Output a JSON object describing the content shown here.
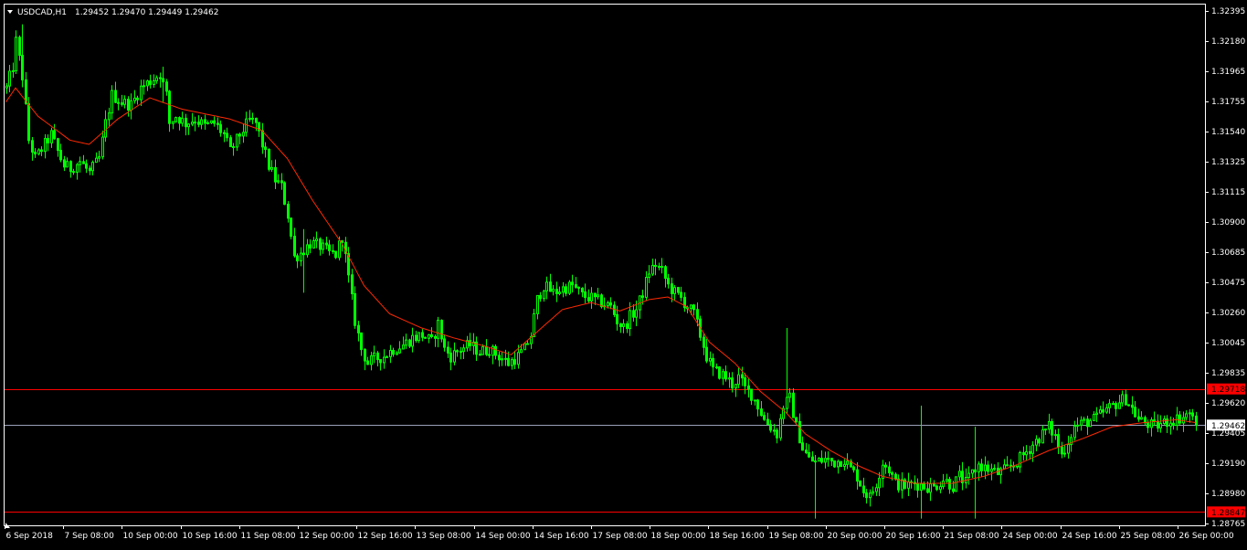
{
  "header": {
    "symbol": "USDCAD,H1",
    "ohlc": "1.29452 1.29470 1.29449 1.29462"
  },
  "colors": {
    "background": "#000000",
    "border": "#ffffff",
    "bull_candle": "#00ff00",
    "bear_candle": "#00ff00",
    "moving_average": "#ff2a00",
    "hline": "#ff0000",
    "bid_line": "#9aa0b8",
    "price_tag_red": "#ff0000",
    "price_tag_bid": "#ffffff"
  },
  "chart_data": {
    "type": "candlestick",
    "symbol": "USDCAD",
    "timeframe": "H1",
    "ylim": [
      1.2876,
      1.3242
    ],
    "y_ticks": [
      "1.32395",
      "1.32180",
      "1.31965",
      "1.31755",
      "1.31540",
      "1.31325",
      "1.31115",
      "1.30900",
      "1.30685",
      "1.30475",
      "1.30260",
      "1.30045",
      "1.29835",
      "1.29620",
      "1.29405",
      "1.29190",
      "1.28980",
      "1.28765"
    ],
    "x_ticks": [
      "6 Sep 2018",
      "7 Sep 08:00",
      "10 Sep 00:00",
      "10 Sep 16:00",
      "11 Sep 08:00",
      "12 Sep 00:00",
      "12 Sep 16:00",
      "13 Sep 08:00",
      "14 Sep 00:00",
      "14 Sep 16:00",
      "17 Sep 08:00",
      "18 Sep 00:00",
      "18 Sep 16:00",
      "19 Sep 08:00",
      "20 Sep 00:00",
      "20 Sep 16:00",
      "21 Sep 08:00",
      "24 Sep 00:00",
      "24 Sep 16:00",
      "25 Sep 08:00",
      "26 Sep 00:00"
    ],
    "path_knots": [
      [
        0,
        1.3185
      ],
      [
        2,
        1.32
      ],
      [
        3,
        1.3218
      ],
      [
        5,
        1.3193
      ],
      [
        7,
        1.3148
      ],
      [
        9,
        1.3135
      ],
      [
        12,
        1.3145
      ],
      [
        14,
        1.3152
      ],
      [
        16,
        1.314
      ],
      [
        18,
        1.313
      ],
      [
        20,
        1.3128
      ],
      [
        23,
        1.3133
      ],
      [
        26,
        1.3125
      ],
      [
        29,
        1.3135
      ],
      [
        31,
        1.316
      ],
      [
        33,
        1.318
      ],
      [
        36,
        1.3175
      ],
      [
        39,
        1.3173
      ],
      [
        42,
        1.3185
      ],
      [
        45,
        1.319
      ],
      [
        48,
        1.3195
      ],
      [
        50,
        1.318
      ],
      [
        51,
        1.316
      ],
      [
        53,
        1.3165
      ],
      [
        56,
        1.316
      ],
      [
        59,
        1.3163
      ],
      [
        62,
        1.3158
      ],
      [
        65,
        1.316
      ],
      [
        68,
        1.3152
      ],
      [
        70,
        1.314
      ],
      [
        73,
        1.3152
      ],
      [
        76,
        1.3162
      ],
      [
        78,
        1.316
      ],
      [
        80,
        1.3145
      ],
      [
        82,
        1.313
      ],
      [
        84,
        1.312
      ],
      [
        86,
        1.3115
      ],
      [
        88,
        1.3095
      ],
      [
        90,
        1.3065
      ],
      [
        92,
        1.3068
      ],
      [
        95,
        1.3075
      ],
      [
        98,
        1.3073
      ],
      [
        101,
        1.3068
      ],
      [
        103,
        1.3067
      ],
      [
        105,
        1.308
      ],
      [
        107,
        1.305
      ],
      [
        109,
        1.302
      ],
      [
        111,
        1.3
      ],
      [
        113,
        1.299
      ],
      [
        115,
        1.2993
      ],
      [
        118,
        1.2995
      ],
      [
        121,
        1.3
      ],
      [
        124,
        1.3003
      ],
      [
        127,
        1.3008
      ],
      [
        130,
        1.301
      ],
      [
        133,
        1.3005
      ],
      [
        135,
        1.3018
      ],
      [
        137,
        1.3
      ],
      [
        139,
        1.2995
      ],
      [
        142,
        1.3
      ],
      [
        145,
        1.3003
      ],
      [
        148,
        1.2998
      ],
      [
        151,
        1.3
      ],
      [
        154,
        1.2995
      ],
      [
        157,
        1.299
      ],
      [
        160,
        1.2995
      ],
      [
        162,
        1.3
      ],
      [
        164,
        1.301
      ],
      [
        166,
        1.3035
      ],
      [
        168,
        1.3045
      ],
      [
        171,
        1.304
      ],
      [
        174,
        1.3043
      ],
      [
        177,
        1.3045
      ],
      [
        180,
        1.3038
      ],
      [
        183,
        1.3036
      ],
      [
        186,
        1.3033
      ],
      [
        189,
        1.303
      ],
      [
        191,
        1.302
      ],
      [
        193,
        1.3015
      ],
      [
        195,
        1.3023
      ],
      [
        197,
        1.3028
      ],
      [
        199,
        1.304
      ],
      [
        201,
        1.3055
      ],
      [
        203,
        1.306
      ],
      [
        205,
        1.3055
      ],
      [
        207,
        1.3045
      ],
      [
        209,
        1.304
      ],
      [
        211,
        1.3036
      ],
      [
        213,
        1.303
      ],
      [
        215,
        1.3025
      ],
      [
        217,
        1.301
      ],
      [
        219,
        1.2995
      ],
      [
        221,
        1.2985
      ],
      [
        223,
        1.2983
      ],
      [
        225,
        1.298
      ],
      [
        227,
        1.2975
      ],
      [
        229,
        1.298
      ],
      [
        231,
        1.2972
      ],
      [
        233,
        1.2968
      ],
      [
        235,
        1.296
      ],
      [
        237,
        1.295
      ],
      [
        239,
        1.2945
      ],
      [
        241,
        1.294
      ],
      [
        243,
        1.296
      ],
      [
        245,
        1.2965
      ],
      [
        247,
        1.2945
      ],
      [
        249,
        1.293
      ],
      [
        251,
        1.2922
      ],
      [
        253,
        1.292
      ],
      [
        256,
        1.2922
      ],
      [
        259,
        1.292
      ],
      [
        262,
        1.2922
      ],
      [
        264,
        1.2915
      ],
      [
        266,
        1.291
      ],
      [
        268,
        1.29
      ],
      [
        270,
        1.2895
      ],
      [
        272,
        1.2905
      ],
      [
        274,
        1.292
      ],
      [
        276,
        1.2915
      ],
      [
        278,
        1.2905
      ],
      [
        281,
        1.2903
      ],
      [
        284,
        1.2905
      ],
      [
        287,
        1.2903
      ],
      [
        290,
        1.2902
      ],
      [
        293,
        1.2908
      ],
      [
        296,
        1.2903
      ],
      [
        298,
        1.291
      ],
      [
        300,
        1.2905
      ],
      [
        302,
        1.2912
      ],
      [
        304,
        1.2918
      ],
      [
        307,
        1.2915
      ],
      [
        310,
        1.2912
      ],
      [
        313,
        1.2915
      ],
      [
        316,
        1.292
      ],
      [
        318,
        1.2925
      ],
      [
        320,
        1.293
      ],
      [
        322,
        1.2935
      ],
      [
        324,
        1.294
      ],
      [
        326,
        1.2945
      ],
      [
        328,
        1.2938
      ],
      [
        330,
        1.2925
      ],
      [
        332,
        1.2935
      ],
      [
        334,
        1.2945
      ],
      [
        337,
        1.2948
      ],
      [
        340,
        1.295
      ],
      [
        343,
        1.2955
      ],
      [
        346,
        1.296
      ],
      [
        348,
        1.2963
      ],
      [
        350,
        1.2965
      ],
      [
        352,
        1.2958
      ],
      [
        354,
        1.295
      ],
      [
        356,
        1.2948
      ],
      [
        359,
        1.2945
      ],
      [
        362,
        1.2948
      ],
      [
        365,
        1.295
      ],
      [
        368,
        1.2952
      ],
      [
        370,
        1.2955
      ],
      [
        371,
        1.295
      ],
      [
        372,
        1.2946
      ]
    ],
    "spikes": [
      [
        244,
        1.3015,
        1.2955
      ],
      [
        286,
        1.296,
        1.288
      ],
      [
        303,
        1.2945,
        1.288
      ],
      [
        5,
        1.323,
        1.319
      ],
      [
        49,
        1.32,
        1.3175
      ],
      [
        93,
        1.3085,
        1.304
      ],
      [
        253,
        1.2925,
        1.288
      ]
    ],
    "moving_average": {
      "color": "#ff2a00",
      "knots": [
        [
          0,
          1.3175
        ],
        [
          3,
          1.3185
        ],
        [
          10,
          1.3165
        ],
        [
          20,
          1.3148
        ],
        [
          26,
          1.3145
        ],
        [
          35,
          1.3163
        ],
        [
          45,
          1.3178
        ],
        [
          55,
          1.317
        ],
        [
          70,
          1.3163
        ],
        [
          80,
          1.3155
        ],
        [
          88,
          1.3135
        ],
        [
          96,
          1.3105
        ],
        [
          105,
          1.3075
        ],
        [
          112,
          1.3045
        ],
        [
          120,
          1.3025
        ],
        [
          130,
          1.3015
        ],
        [
          140,
          1.3008
        ],
        [
          150,
          1.3002
        ],
        [
          158,
          1.2996
        ],
        [
          166,
          1.3012
        ],
        [
          174,
          1.3028
        ],
        [
          183,
          1.3033
        ],
        [
          192,
          1.3027
        ],
        [
          201,
          1.3035
        ],
        [
          207,
          1.3037
        ],
        [
          213,
          1.303
        ],
        [
          220,
          1.3005
        ],
        [
          228,
          1.299
        ],
        [
          236,
          1.297
        ],
        [
          244,
          1.2955
        ],
        [
          250,
          1.294
        ],
        [
          258,
          1.2928
        ],
        [
          266,
          1.2918
        ],
        [
          274,
          1.291
        ],
        [
          284,
          1.2905
        ],
        [
          296,
          1.2905
        ],
        [
          306,
          1.291
        ],
        [
          316,
          1.2918
        ],
        [
          326,
          1.2928
        ],
        [
          336,
          1.2936
        ],
        [
          346,
          1.2945
        ],
        [
          356,
          1.2948
        ],
        [
          366,
          1.295
        ],
        [
          372,
          1.2948
        ]
      ]
    },
    "horizontal_lines": [
      {
        "price": 1.29718,
        "label": "1.29718",
        "color": "#ff0000"
      },
      {
        "price": 1.28847,
        "label": "1.28847",
        "color": "#ff0000"
      }
    ],
    "bid_line": {
      "price": 1.29462,
      "label": "1.29462"
    },
    "grid": false,
    "legend": "none"
  }
}
